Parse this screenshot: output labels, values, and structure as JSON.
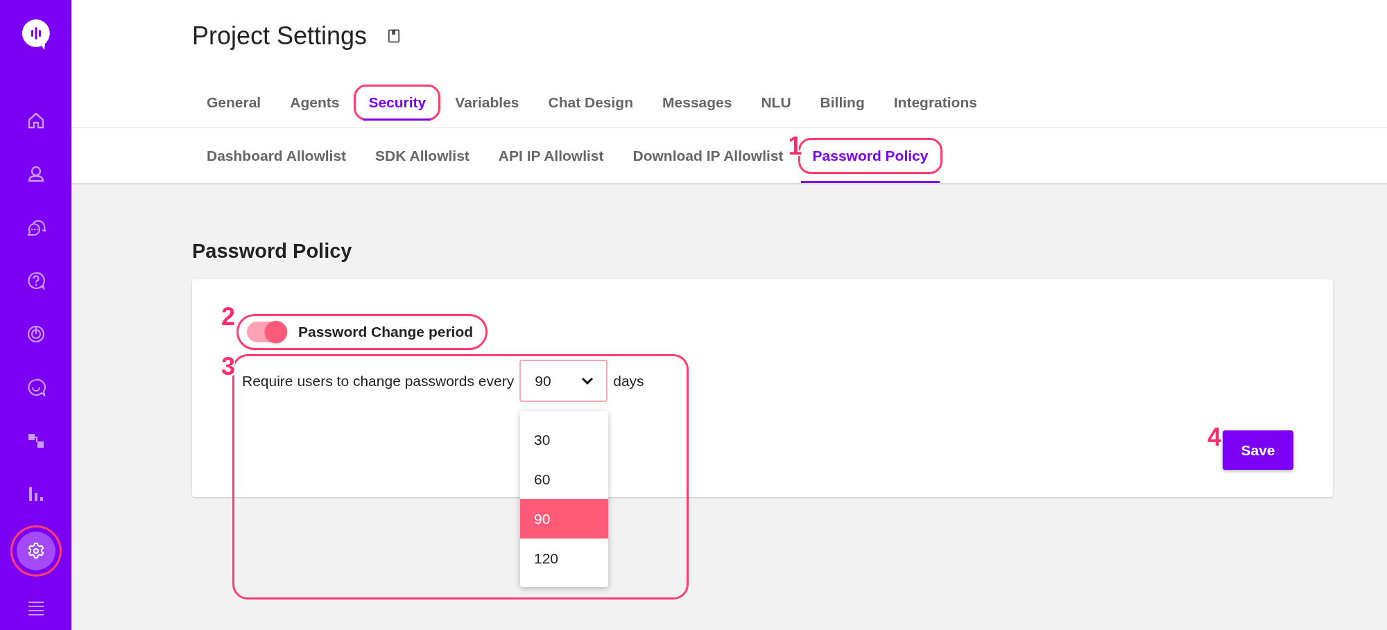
{
  "sidebar": {
    "items": [
      {
        "kind": "home",
        "selected": false,
        "highlighted": false
      },
      {
        "kind": "person",
        "selected": false,
        "highlighted": false
      },
      {
        "kind": "chat",
        "selected": false,
        "highlighted": false
      },
      {
        "kind": "help",
        "selected": false,
        "highlighted": false
      },
      {
        "kind": "target",
        "selected": false,
        "highlighted": false
      },
      {
        "kind": "smile",
        "selected": false,
        "highlighted": false
      },
      {
        "kind": "flow",
        "selected": false,
        "highlighted": false
      },
      {
        "kind": "bars",
        "selected": false,
        "highlighted": false
      },
      {
        "kind": "settings",
        "selected": true,
        "highlighted": true
      },
      {
        "kind": "menu",
        "selected": false,
        "highlighted": false
      }
    ]
  },
  "header": {
    "title": "Project Settings"
  },
  "tabs": [
    {
      "label": "General",
      "selected": false,
      "highlighted": false
    },
    {
      "label": "Agents",
      "selected": false,
      "highlighted": false
    },
    {
      "label": "Security",
      "selected": true,
      "highlighted": true
    },
    {
      "label": "Variables",
      "selected": false,
      "highlighted": false
    },
    {
      "label": "Chat Design",
      "selected": false,
      "highlighted": false
    },
    {
      "label": "Messages",
      "selected": false,
      "highlighted": false
    },
    {
      "label": "NLU",
      "selected": false,
      "highlighted": false
    },
    {
      "label": "Billing",
      "selected": false,
      "highlighted": false
    },
    {
      "label": "Integrations",
      "selected": false,
      "highlighted": false
    }
  ],
  "subtabs": [
    {
      "label": "Dashboard Allowlist",
      "selected": false,
      "highlighted": false
    },
    {
      "label": "SDK Allowlist",
      "selected": false,
      "highlighted": false
    },
    {
      "label": "API IP Allowlist",
      "selected": false,
      "highlighted": false
    },
    {
      "label": "Download IP Allowlist",
      "selected": false,
      "highlighted": false
    },
    {
      "label": "Password Policy",
      "selected": true,
      "highlighted": true,
      "callout": "1"
    }
  ],
  "section": {
    "title": "Password Policy"
  },
  "toggle": {
    "label": "Password Change period",
    "on": true,
    "callout": "2"
  },
  "period": {
    "prefix": "Require users to change passwords every",
    "value": "90",
    "suffix": "days",
    "callout": "3",
    "options": [
      {
        "label": "30",
        "selected": false
      },
      {
        "label": "60",
        "selected": false
      },
      {
        "label": "90",
        "selected": true
      },
      {
        "label": "120",
        "selected": false
      }
    ]
  },
  "save": {
    "label": "Save",
    "callout": "4"
  }
}
